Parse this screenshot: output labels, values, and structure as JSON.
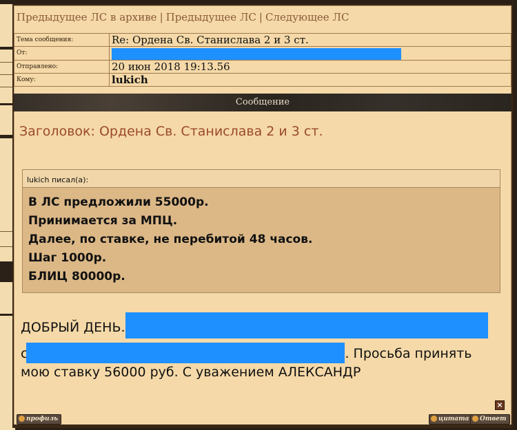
{
  "nav": {
    "prev_archive": "Предыдущее ЛС в архиве",
    "prev": "Предыдущее ЛС",
    "next": "Следующее ЛС",
    "separator": "|"
  },
  "header": {
    "subject_label": "Тема сообщения:",
    "subject_value": "Re: Ордена Св. Станислава 2 и 3 ст.",
    "from_label": "От:",
    "sent_label": "Отправлено:",
    "sent_value": "20 июн 2018 19:13.56",
    "to_label": "Кому:",
    "to_value": "lukich"
  },
  "message_bar_title": "Сообщение",
  "subject_line": "Заголовок: Ордена Св. Станислава 2 и 3 ст.",
  "quote": {
    "author": "lukich писал(а):",
    "lines": [
      "В ЛС предложили 55000р.",
      "Принимается за МПЦ.",
      "Далее, по ставке, не перебитой 48 часов.",
      "Шаг 1000р.",
      "БЛИЦ 80000р."
    ]
  },
  "body": {
    "line1": "ДОБРЫЙ ДЕНЬ.",
    "line2_prefix": "с",
    "line2_suffix": ". Просьба принять",
    "line3": "мою ставку 56000 руб. С уважением АЛЕКСАНДР"
  },
  "buttons": {
    "close": "×",
    "profile": "профиль",
    "quote": "цитата",
    "reply": "Ответ"
  },
  "colors": {
    "redaction": "#1e90ff",
    "background": "#f5d9a8",
    "accent_title": "#9a4a2a"
  }
}
